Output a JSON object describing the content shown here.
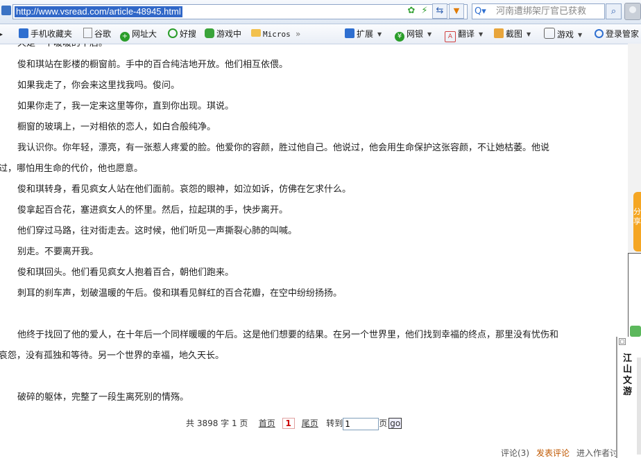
{
  "address_bar": {
    "url": "http://www.vsread.com/article-48945.html",
    "search_text": "河南遭绑架厅官已获救"
  },
  "favorites": [
    {
      "label": "手机收藏夹",
      "icon": "phone-icon"
    },
    {
      "label": "谷歌",
      "icon": "page-icon"
    },
    {
      "label": "网址大",
      "icon": "globe-icon"
    },
    {
      "label": "好搜",
      "icon": "search-icon"
    },
    {
      "label": "游戏中",
      "icon": "gamepad-icon"
    },
    {
      "label": "Micros",
      "icon": "folder-icon"
    },
    {
      "label": "»",
      "icon": "chevron-right-icon"
    }
  ],
  "toolbar_right": [
    {
      "label": "扩展",
      "icon": "puzzle-icon"
    },
    {
      "label": "网银",
      "icon": "bank-icon"
    },
    {
      "label": "翻译",
      "icon": "translate-icon"
    },
    {
      "label": "截图",
      "icon": "screenshot-icon"
    },
    {
      "label": "游戏",
      "icon": "game-icon"
    },
    {
      "label": "登录管家",
      "icon": "login-icon"
    }
  ],
  "article": {
    "top_partial": "天是一个暖暖的午后。",
    "paragraphs": [
      "俊和琪站在影楼的橱窗前。手中的百合纯洁地开放。他们相互依偎。",
      "如果我走了，你会来这里找我吗。俊问。",
      "如果你走了，我一定来这里等你，直到你出现。琪说。",
      "橱窗的玻璃上，一对相依的恋人，如白合般纯净。",
      "我认识你。你年轻，漂亮，有一张惹人疼爱的脸。他爱你的容颜，胜过他自己。他说过，他会用生命保护这张容颜，不让她枯萎。他说",
      "过，哪怕用生命的代价，他也愿意。",
      "俊和琪转身，看见疯女人站在他们面前。哀怨的眼神，如泣如诉，仿佛在乞求什么。",
      "俊拿起百合花，塞进疯女人的怀里。然后，拉起琪的手，快步离开。",
      "他们穿过马路，往对街走去。这时候，他们听见一声撕裂心肺的叫喊。",
      "别走。不要离开我。",
      "俊和琪回头。他们看见疯女人抱着百合，朝他们跑来。",
      "刺耳的刹车声，划破温暖的午后。俊和琪看见鲜红的百合花瓣，在空中纷纷扬扬。",
      "他终于找回了他的爱人，在十年后一个同样暖暖的午后。这是他们想要的结果。在另一个世界里，他们找到幸福的终点，那里没有忧伤和",
      "哀怨，没有孤独和等待。另一个世界的幸福，地久天长。",
      "破碎的躯体，完整了一段生离死别的情殇。"
    ]
  },
  "pager": {
    "summary": "共 3898 字 1 页",
    "first": "首页",
    "current": "1",
    "last": "尾页",
    "goto": "转到",
    "input_value": "1",
    "page_unit": "页",
    "go": "go"
  },
  "footer": {
    "comments": "评论(3)",
    "post_comment": "发表评论",
    "author": "进入作者讨"
  },
  "side_panel": {
    "share": "分享",
    "river_title": "江山文游"
  }
}
